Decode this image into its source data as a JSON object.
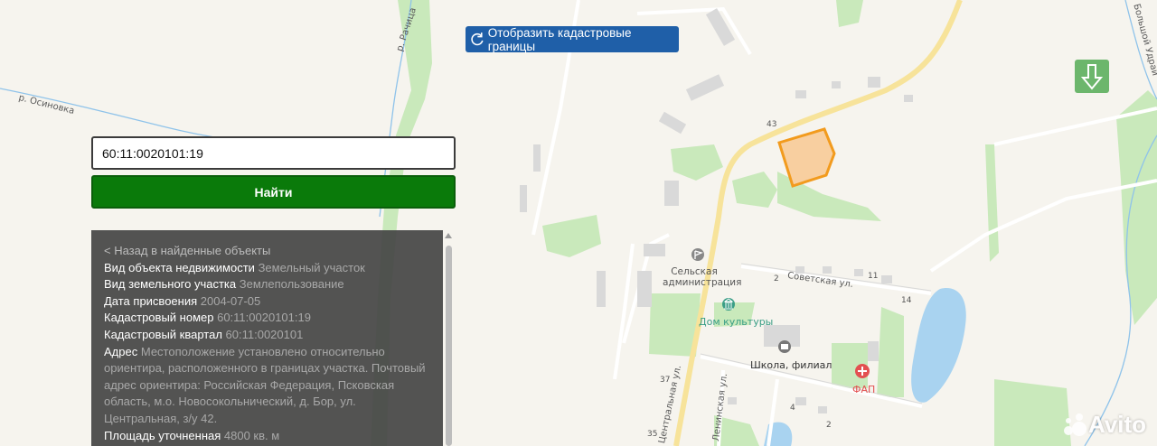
{
  "toolbar": {
    "cadastral_label": "Отобразить кадастровые границы"
  },
  "search": {
    "value": "60:11:0020101:19",
    "button_label": "Найти"
  },
  "result": {
    "back_link": "< Назад в найденные объекты",
    "fields": [
      {
        "label": "Вид объекта недвижимости",
        "value": "Земельный участок"
      },
      {
        "label": "Вид земельного участка",
        "value": "Землепользование"
      },
      {
        "label": "Дата присвоения",
        "value": "2004-07-05"
      },
      {
        "label": "Кадастровый номер",
        "value": "60:11:0020101:19"
      },
      {
        "label": "Кадастровый квартал",
        "value": "60:11:0020101"
      },
      {
        "label": "Адрес",
        "value": "Местоположение установлено относительно ориентира, расположенного в границах участка. Почтовый адрес ориентира: Российская Федерация, Псковская область, м.о. Новосокольнический, д. Бор, ул. Центральная, з/у 42."
      },
      {
        "label": "Площадь уточненная",
        "value": "4800 кв. м"
      }
    ]
  },
  "map": {
    "rivers": [
      "р. Осиновка",
      "р. Рачица",
      "Большой Удрай"
    ],
    "streets": [
      "Советская ул.",
      "Центральная ул.",
      "Ленинская ул."
    ],
    "pois": {
      "admin": "Сельская администрация",
      "culture": "Дом культуры",
      "school": "Школа, филиал",
      "fap": "ФАП"
    },
    "house_numbers": [
      "43",
      "11",
      "14",
      "2",
      "37",
      "4",
      "2",
      "35"
    ],
    "colors": {
      "parcel_stroke": "#f29b1e",
      "parcel_fill": "#f8cfa0",
      "road": "#f7e39a",
      "green": "#c5e8b6",
      "water": "#a9d3f0"
    }
  },
  "watermark": "Avito"
}
